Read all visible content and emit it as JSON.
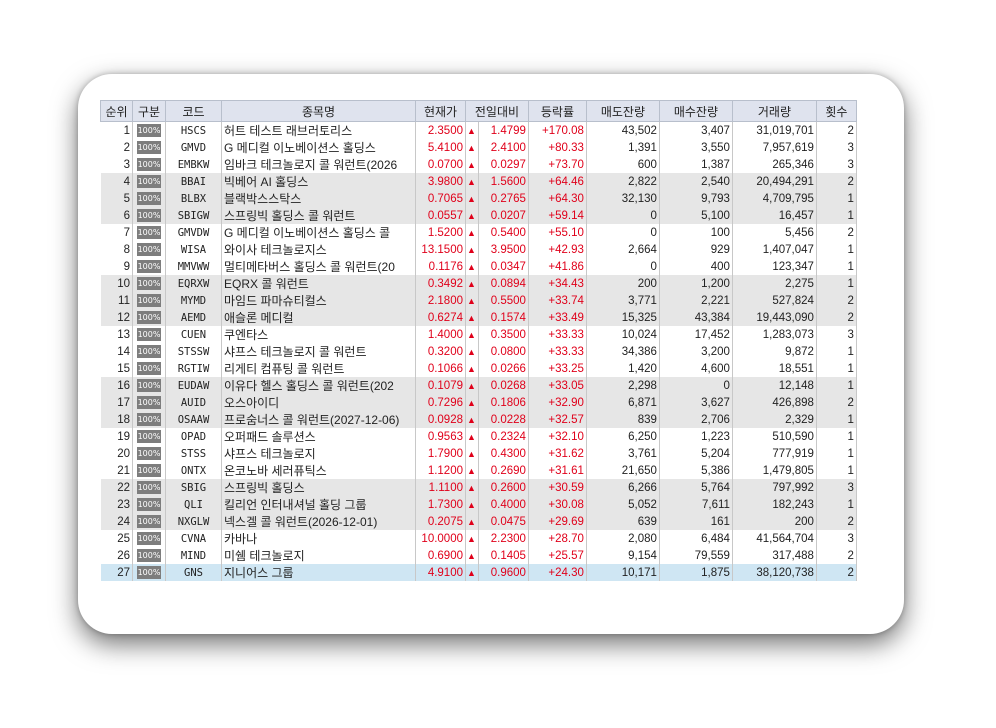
{
  "columns": {
    "rank": "순위",
    "type": "구분",
    "code": "코드",
    "name": "종목명",
    "price": "현재가",
    "change": "전일대비",
    "rate": "등락률",
    "ask": "매도잔량",
    "bid": "매수잔량",
    "volume": "거래량",
    "count": "횟수"
  },
  "up_arrow": "▲",
  "colors": {
    "rise": "#e0001a",
    "header_bg": "#dfe3ee",
    "shade_bg": "#e6e6e6",
    "selected_bg": "#cfe6f3"
  },
  "selected_rank": "27",
  "rows": [
    {
      "rank": "1",
      "badge": "100%",
      "code": "HSCS",
      "name": "허트 테스트 래브러토리스",
      "price": "2.3500",
      "change": "1.4799",
      "rate": "+170.08",
      "ask": "43,502",
      "bid": "3,407",
      "volume": "31,019,701",
      "count": "2",
      "shade": false
    },
    {
      "rank": "2",
      "badge": "100%",
      "code": "GMVD",
      "name": "G 메디컬 이노베이션스 홀딩스",
      "price": "5.4100",
      "change": "2.4100",
      "rate": "+80.33",
      "ask": "1,391",
      "bid": "3,550",
      "volume": "7,957,619",
      "count": "3",
      "shade": false
    },
    {
      "rank": "3",
      "badge": "100%",
      "code": "EMBKW",
      "name": "임바크 테크놀로지 콜 워런트(2026",
      "price": "0.0700",
      "change": "0.0297",
      "rate": "+73.70",
      "ask": "600",
      "bid": "1,387",
      "volume": "265,346",
      "count": "3",
      "shade": false
    },
    {
      "rank": "4",
      "badge": "100%",
      "code": "BBAI",
      "name": "빅베어 AI 홀딩스",
      "price": "3.9800",
      "change": "1.5600",
      "rate": "+64.46",
      "ask": "2,822",
      "bid": "2,540",
      "volume": "20,494,291",
      "count": "2",
      "shade": true
    },
    {
      "rank": "5",
      "badge": "100%",
      "code": "BLBX",
      "name": "블랙박스스탁스",
      "price": "0.7065",
      "change": "0.2765",
      "rate": "+64.30",
      "ask": "32,130",
      "bid": "9,793",
      "volume": "4,709,795",
      "count": "1",
      "shade": true
    },
    {
      "rank": "6",
      "badge": "100%",
      "code": "SBIGW",
      "name": "스프링빅 홀딩스 콜 워런트",
      "price": "0.0557",
      "change": "0.0207",
      "rate": "+59.14",
      "ask": "0",
      "bid": "5,100",
      "volume": "16,457",
      "count": "1",
      "shade": true
    },
    {
      "rank": "7",
      "badge": "100%",
      "code": "GMVDW",
      "name": "G 메디컬 이노베이션스 홀딩스 콜",
      "price": "1.5200",
      "change": "0.5400",
      "rate": "+55.10",
      "ask": "0",
      "bid": "100",
      "volume": "5,456",
      "count": "2",
      "shade": false
    },
    {
      "rank": "8",
      "badge": "100%",
      "code": "WISA",
      "name": "와이사 테크놀로지스",
      "price": "13.1500",
      "change": "3.9500",
      "rate": "+42.93",
      "ask": "2,664",
      "bid": "929",
      "volume": "1,407,047",
      "count": "1",
      "shade": false
    },
    {
      "rank": "9",
      "badge": "100%",
      "code": "MMVWW",
      "name": "멀티메타버스 홀딩스 콜 워런트(20",
      "price": "0.1176",
      "change": "0.0347",
      "rate": "+41.86",
      "ask": "0",
      "bid": "400",
      "volume": "123,347",
      "count": "1",
      "shade": false
    },
    {
      "rank": "10",
      "badge": "100%",
      "code": "EQRXW",
      "name": "EQRX 콜 워런트",
      "price": "0.3492",
      "change": "0.0894",
      "rate": "+34.43",
      "ask": "200",
      "bid": "1,200",
      "volume": "2,275",
      "count": "1",
      "shade": true
    },
    {
      "rank": "11",
      "badge": "100%",
      "code": "MYMD",
      "name": "마임드 파마슈티컬스",
      "price": "2.1800",
      "change": "0.5500",
      "rate": "+33.74",
      "ask": "3,771",
      "bid": "2,221",
      "volume": "527,824",
      "count": "2",
      "shade": true
    },
    {
      "rank": "12",
      "badge": "100%",
      "code": "AEMD",
      "name": "애슬론 메디컬",
      "price": "0.6274",
      "change": "0.1574",
      "rate": "+33.49",
      "ask": "15,325",
      "bid": "43,384",
      "volume": "19,443,090",
      "count": "2",
      "shade": true
    },
    {
      "rank": "13",
      "badge": "100%",
      "code": "CUEN",
      "name": "쿠엔타스",
      "price": "1.4000",
      "change": "0.3500",
      "rate": "+33.33",
      "ask": "10,024",
      "bid": "17,452",
      "volume": "1,283,073",
      "count": "3",
      "shade": false
    },
    {
      "rank": "14",
      "badge": "100%",
      "code": "STSSW",
      "name": "샤프스 테크놀로지 콜 워런트",
      "price": "0.3200",
      "change": "0.0800",
      "rate": "+33.33",
      "ask": "34,386",
      "bid": "3,200",
      "volume": "9,872",
      "count": "1",
      "shade": false
    },
    {
      "rank": "15",
      "badge": "100%",
      "code": "RGTIW",
      "name": "리게티 컴퓨팅 콜 워런트",
      "price": "0.1066",
      "change": "0.0266",
      "rate": "+33.25",
      "ask": "1,420",
      "bid": "4,600",
      "volume": "18,551",
      "count": "1",
      "shade": false
    },
    {
      "rank": "16",
      "badge": "100%",
      "code": "EUDAW",
      "name": "이유다 헬스 홀딩스 콜 워런트(202",
      "price": "0.1079",
      "change": "0.0268",
      "rate": "+33.05",
      "ask": "2,298",
      "bid": "0",
      "volume": "12,148",
      "count": "1",
      "shade": true
    },
    {
      "rank": "17",
      "badge": "100%",
      "code": "AUID",
      "name": "오스아이디",
      "price": "0.7296",
      "change": "0.1806",
      "rate": "+32.90",
      "ask": "6,871",
      "bid": "3,627",
      "volume": "426,898",
      "count": "2",
      "shade": true
    },
    {
      "rank": "18",
      "badge": "100%",
      "code": "OSAAW",
      "name": "프로숨너스 콜 워런트(2027-12-06)",
      "price": "0.0928",
      "change": "0.0228",
      "rate": "+32.57",
      "ask": "839",
      "bid": "2,706",
      "volume": "2,329",
      "count": "1",
      "shade": true
    },
    {
      "rank": "19",
      "badge": "100%",
      "code": "OPAD",
      "name": "오퍼패드 솔루션스",
      "price": "0.9563",
      "change": "0.2324",
      "rate": "+32.10",
      "ask": "6,250",
      "bid": "1,223",
      "volume": "510,590",
      "count": "1",
      "shade": false
    },
    {
      "rank": "20",
      "badge": "100%",
      "code": "STSS",
      "name": "샤프스 테크놀로지",
      "price": "1.7900",
      "change": "0.4300",
      "rate": "+31.62",
      "ask": "3,761",
      "bid": "5,204",
      "volume": "777,919",
      "count": "1",
      "shade": false
    },
    {
      "rank": "21",
      "badge": "100%",
      "code": "ONTX",
      "name": "온코노바 세러퓨틱스",
      "price": "1.1200",
      "change": "0.2690",
      "rate": "+31.61",
      "ask": "21,650",
      "bid": "5,386",
      "volume": "1,479,805",
      "count": "1",
      "shade": false
    },
    {
      "rank": "22",
      "badge": "100%",
      "code": "SBIG",
      "name": "스프링빅 홀딩스",
      "price": "1.1100",
      "change": "0.2600",
      "rate": "+30.59",
      "ask": "6,266",
      "bid": "5,764",
      "volume": "797,992",
      "count": "3",
      "shade": true
    },
    {
      "rank": "23",
      "badge": "100%",
      "code": "QLI",
      "name": "킬리언 인터내셔널 홀딩 그룹",
      "price": "1.7300",
      "change": "0.4000",
      "rate": "+30.08",
      "ask": "5,052",
      "bid": "7,611",
      "volume": "182,243",
      "count": "1",
      "shade": true
    },
    {
      "rank": "24",
      "badge": "100%",
      "code": "NXGLW",
      "name": "넥스겔 콜 워런트(2026-12-01)",
      "price": "0.2075",
      "change": "0.0475",
      "rate": "+29.69",
      "ask": "639",
      "bid": "161",
      "volume": "200",
      "count": "2",
      "shade": true
    },
    {
      "rank": "25",
      "badge": "100%",
      "code": "CVNA",
      "name": "카바나",
      "price": "10.0000",
      "change": "2.2300",
      "rate": "+28.70",
      "ask": "2,080",
      "bid": "6,484",
      "volume": "41,564,704",
      "count": "3",
      "shade": false
    },
    {
      "rank": "26",
      "badge": "100%",
      "code": "MIND",
      "name": "미쉠 테크놀로지",
      "price": "0.6900",
      "change": "0.1405",
      "rate": "+25.57",
      "ask": "9,154",
      "bid": "79,559",
      "volume": "317,488",
      "count": "2",
      "shade": false
    },
    {
      "rank": "27",
      "badge": "100%",
      "code": "GNS",
      "name": "지니어스 그룹",
      "price": "4.9100",
      "change": "0.9600",
      "rate": "+24.30",
      "ask": "10,171",
      "bid": "1,875",
      "volume": "38,120,738",
      "count": "2",
      "shade": false
    }
  ]
}
